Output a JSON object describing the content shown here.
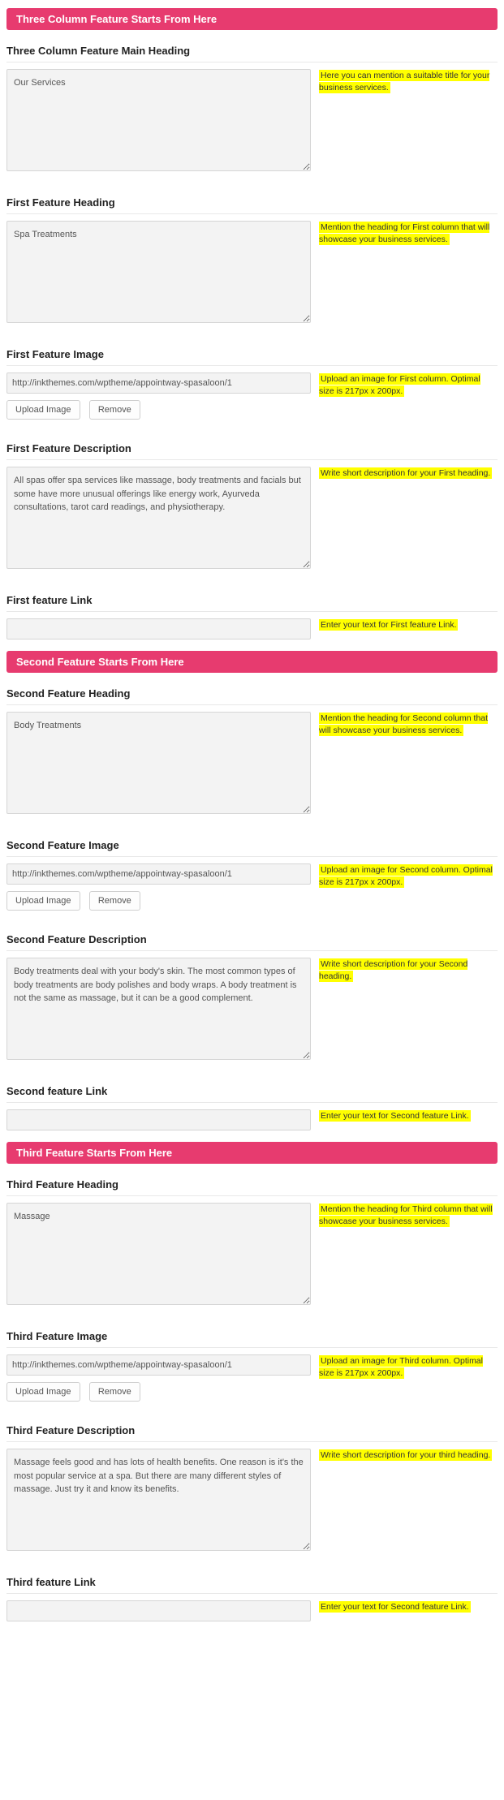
{
  "sections": {
    "three_col_header": "Three Column Feature Starts From Here",
    "second_header": "Second Feature Starts From Here",
    "third_header": "Third Feature Starts From Here"
  },
  "buttons": {
    "upload": "Upload Image",
    "remove": "Remove"
  },
  "main_heading": {
    "label": "Three Column Feature Main Heading",
    "value": "Our Services",
    "hint": "Here you can mention a suitable title for your business services."
  },
  "f1_heading": {
    "label": "First Feature Heading",
    "value": "Spa Treatments",
    "hint": "Mention the heading for First column that will showcase your business services."
  },
  "f1_image": {
    "label": "First Feature Image",
    "value": "http://inkthemes.com/wptheme/appointway-spasaloon/1",
    "hint": "Upload an image for First column. Optimal size is 217px x 200px."
  },
  "f1_desc": {
    "label": "First Feature Description",
    "value": "All spas offer spa services like massage, body treatments and facials but some have more unusual offerings like energy work, Ayurveda consultations, tarot card readings, and physiotherapy.",
    "hint": "Write short description for your First heading."
  },
  "f1_link": {
    "label": "First feature Link",
    "value": "",
    "hint": "Enter your text for First feature Link."
  },
  "f2_heading": {
    "label": "Second Feature Heading",
    "value": "Body Treatments",
    "hint": "Mention the heading for Second column that will showcase your business services."
  },
  "f2_image": {
    "label": "Second Feature Image",
    "value": "http://inkthemes.com/wptheme/appointway-spasaloon/1",
    "hint": "Upload an image for Second column. Optimal size is 217px x 200px."
  },
  "f2_desc": {
    "label": "Second Feature Description",
    "value": "Body treatments deal with your body's skin. The most common types of body treatments are body polishes and body wraps. A body treatment is not the same as massage, but it can be a good complement.",
    "hint": "Write short description for your Second heading."
  },
  "f2_link": {
    "label": "Second feature Link",
    "value": "",
    "hint": "Enter your text for Second feature Link."
  },
  "f3_heading": {
    "label": "Third Feature Heading",
    "value": "Massage",
    "hint": "Mention the heading for Third column that will showcase your business services."
  },
  "f3_image": {
    "label": "Third Feature Image",
    "value": "http://inkthemes.com/wptheme/appointway-spasaloon/1",
    "hint": "Upload an image for Third column. Optimal size is 217px x 200px."
  },
  "f3_desc": {
    "label": "Third Feature Description",
    "value": "Massage feels good and has lots of health benefits. One reason is it's the most popular service at a spa. But there are many different styles of massage. Just try it and know its benefits.",
    "hint": "Write short description for your third heading."
  },
  "f3_link": {
    "label": "Third feature Link",
    "value": "",
    "hint": "Enter your text for Second feature Link."
  }
}
